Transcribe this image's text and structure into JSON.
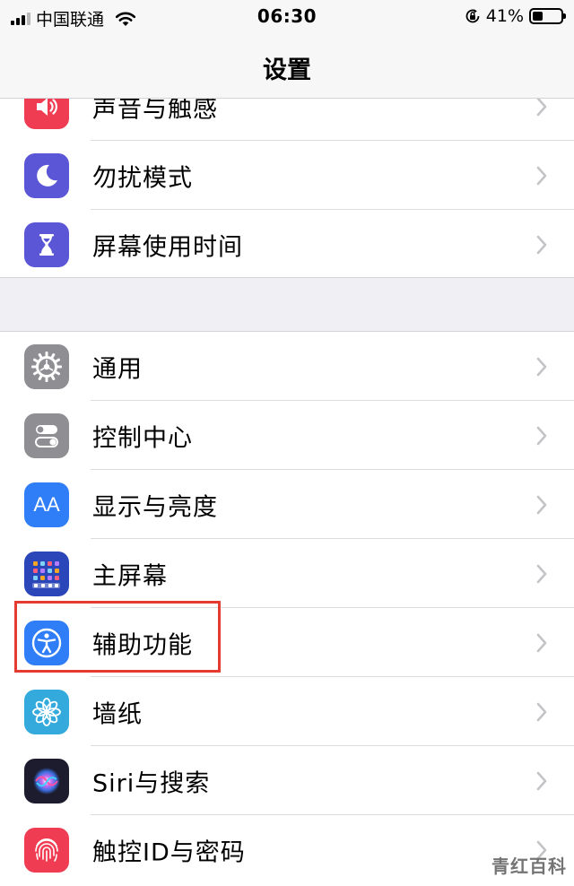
{
  "status_bar": {
    "carrier": "中国联通",
    "time": "06:30",
    "battery_percent": "41%",
    "battery_level": 0.41
  },
  "nav": {
    "title": "设置"
  },
  "groups": [
    {
      "items": [
        {
          "label": "声音与触感",
          "icon": "speaker-icon",
          "color": "#f03c53"
        },
        {
          "label": "勿扰模式",
          "icon": "moon-icon",
          "color": "#5b56d6"
        },
        {
          "label": "屏幕使用时间",
          "icon": "hourglass-icon",
          "color": "#5b56d6"
        }
      ]
    },
    {
      "items": [
        {
          "label": "通用",
          "icon": "gear-icon",
          "color": "#8e8e93"
        },
        {
          "label": "控制中心",
          "icon": "toggle-switches-icon",
          "color": "#8e8e93"
        },
        {
          "label": "显示与亮度",
          "icon": "text-size-icon",
          "color": "#2f7ef7",
          "glyph": "AA"
        },
        {
          "label": "主屏幕",
          "icon": "app-grid-icon",
          "color": "#2b46b8"
        },
        {
          "label": "辅助功能",
          "icon": "accessibility-icon",
          "color": "#2f7ef7",
          "highlighted": true
        },
        {
          "label": "墙纸",
          "icon": "flower-icon",
          "color": "#34aadc"
        },
        {
          "label": "Siri与搜索",
          "icon": "siri-icon",
          "color": "#1c1c2e"
        },
        {
          "label": "触控ID与密码",
          "icon": "fingerprint-icon",
          "color": "#f03c53"
        }
      ]
    }
  ],
  "watermark": "青红百科",
  "colors": {
    "highlight_border": "#e53a30",
    "chevron": "#c4c4c7",
    "background": "#efeff4"
  }
}
